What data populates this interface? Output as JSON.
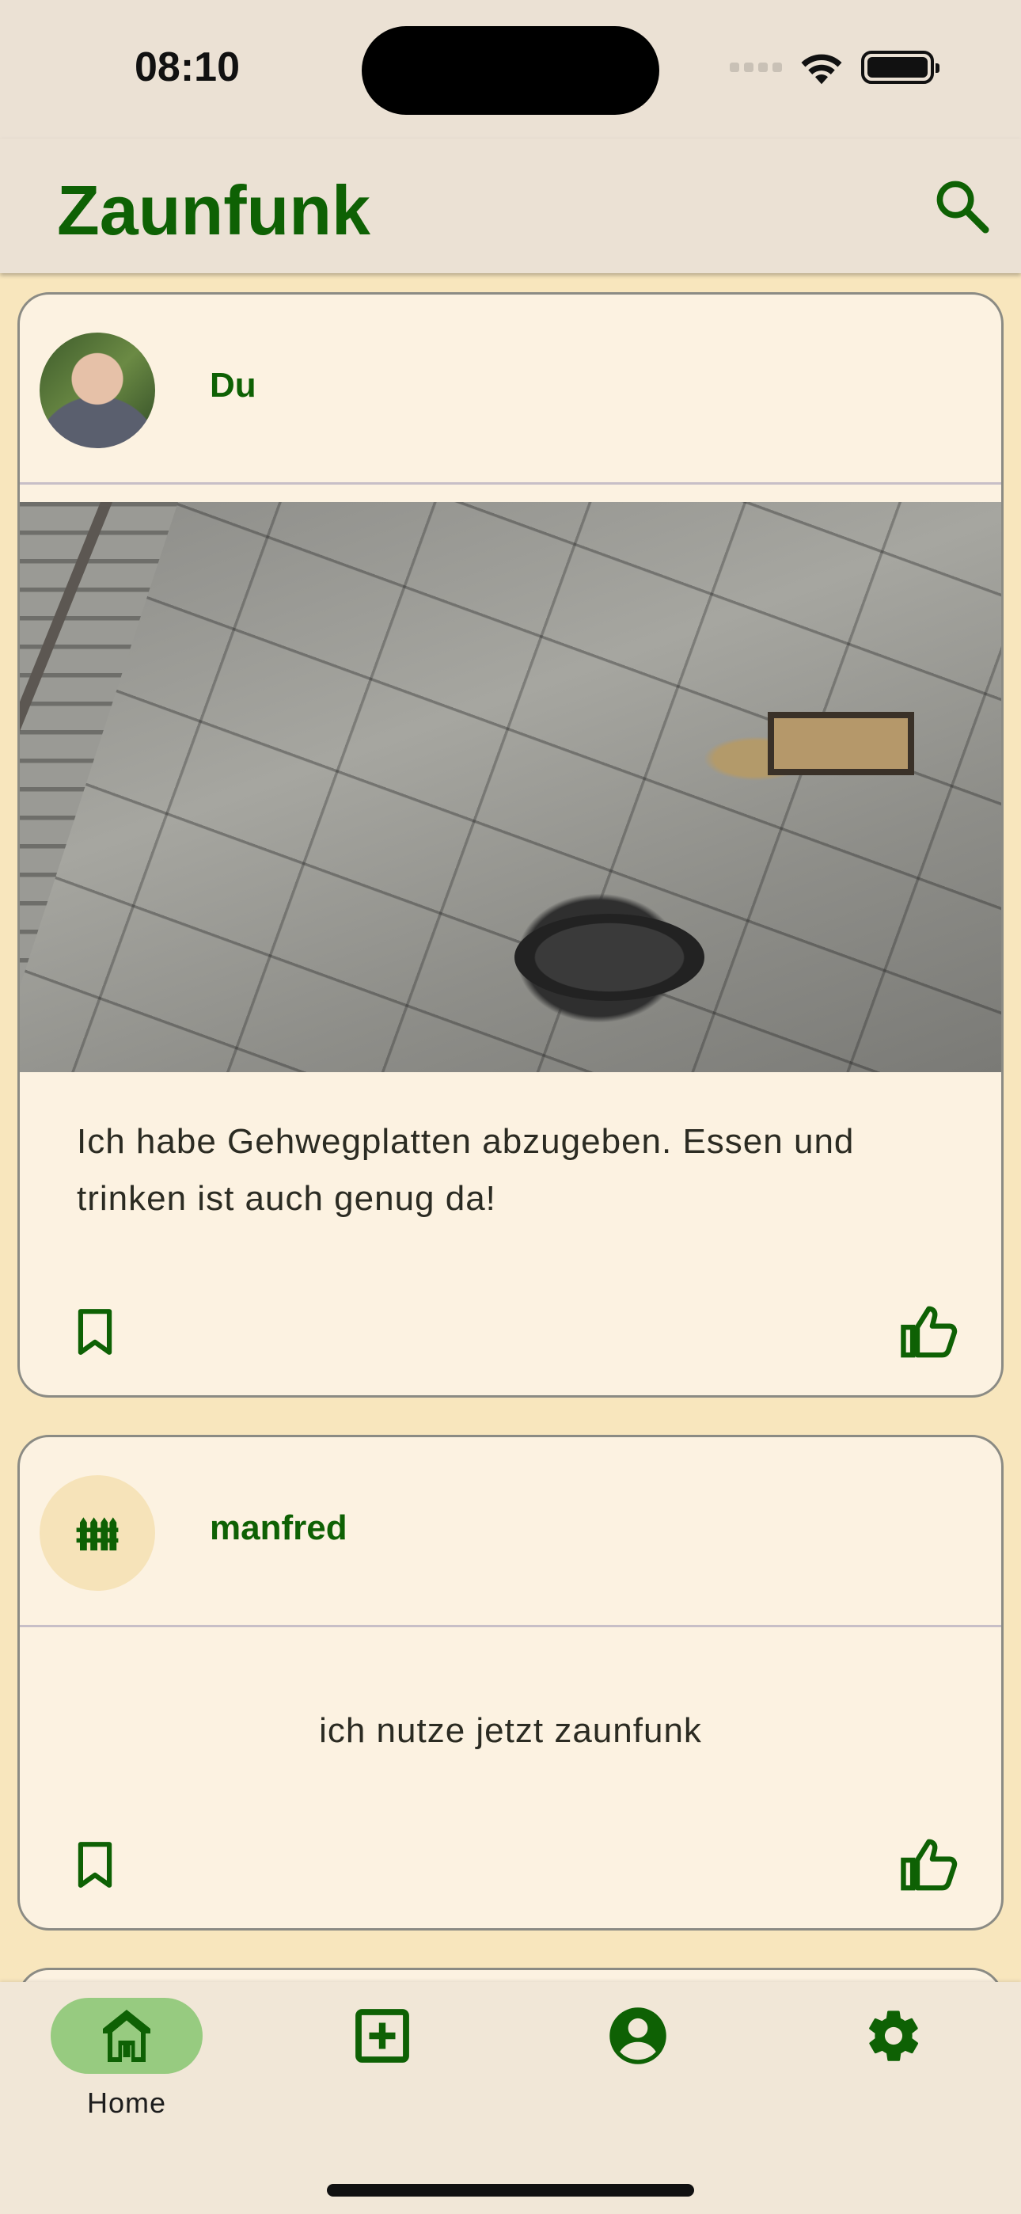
{
  "status_bar": {
    "time": "08:10"
  },
  "app_bar": {
    "title": "Zaunfunk",
    "search_icon": "search-icon"
  },
  "posts": [
    {
      "author": "Du",
      "avatar": "user-photo",
      "has_image": true,
      "image_description_icon": "post-photo",
      "text": "Ich habe Gehwegplatten abzugeben. Essen und trinken ist auch genug da!"
    },
    {
      "author": "manfred",
      "avatar": "fence-icon",
      "has_image": false,
      "text": "ich nutze jetzt zaunfunk"
    }
  ],
  "bottom_nav": {
    "items": [
      {
        "label": "Home",
        "icon": "home-icon",
        "active": true
      },
      {
        "label": "",
        "icon": "add-post-icon",
        "active": false
      },
      {
        "label": "",
        "icon": "profile-icon",
        "active": false
      },
      {
        "label": "",
        "icon": "settings-icon",
        "active": false
      }
    ]
  },
  "colors": {
    "primary": "#0e6104",
    "background": "#f8e6bd",
    "card": "#fcf2e1",
    "bar": "#ebe1d4",
    "nav_active": "#97cb80"
  }
}
